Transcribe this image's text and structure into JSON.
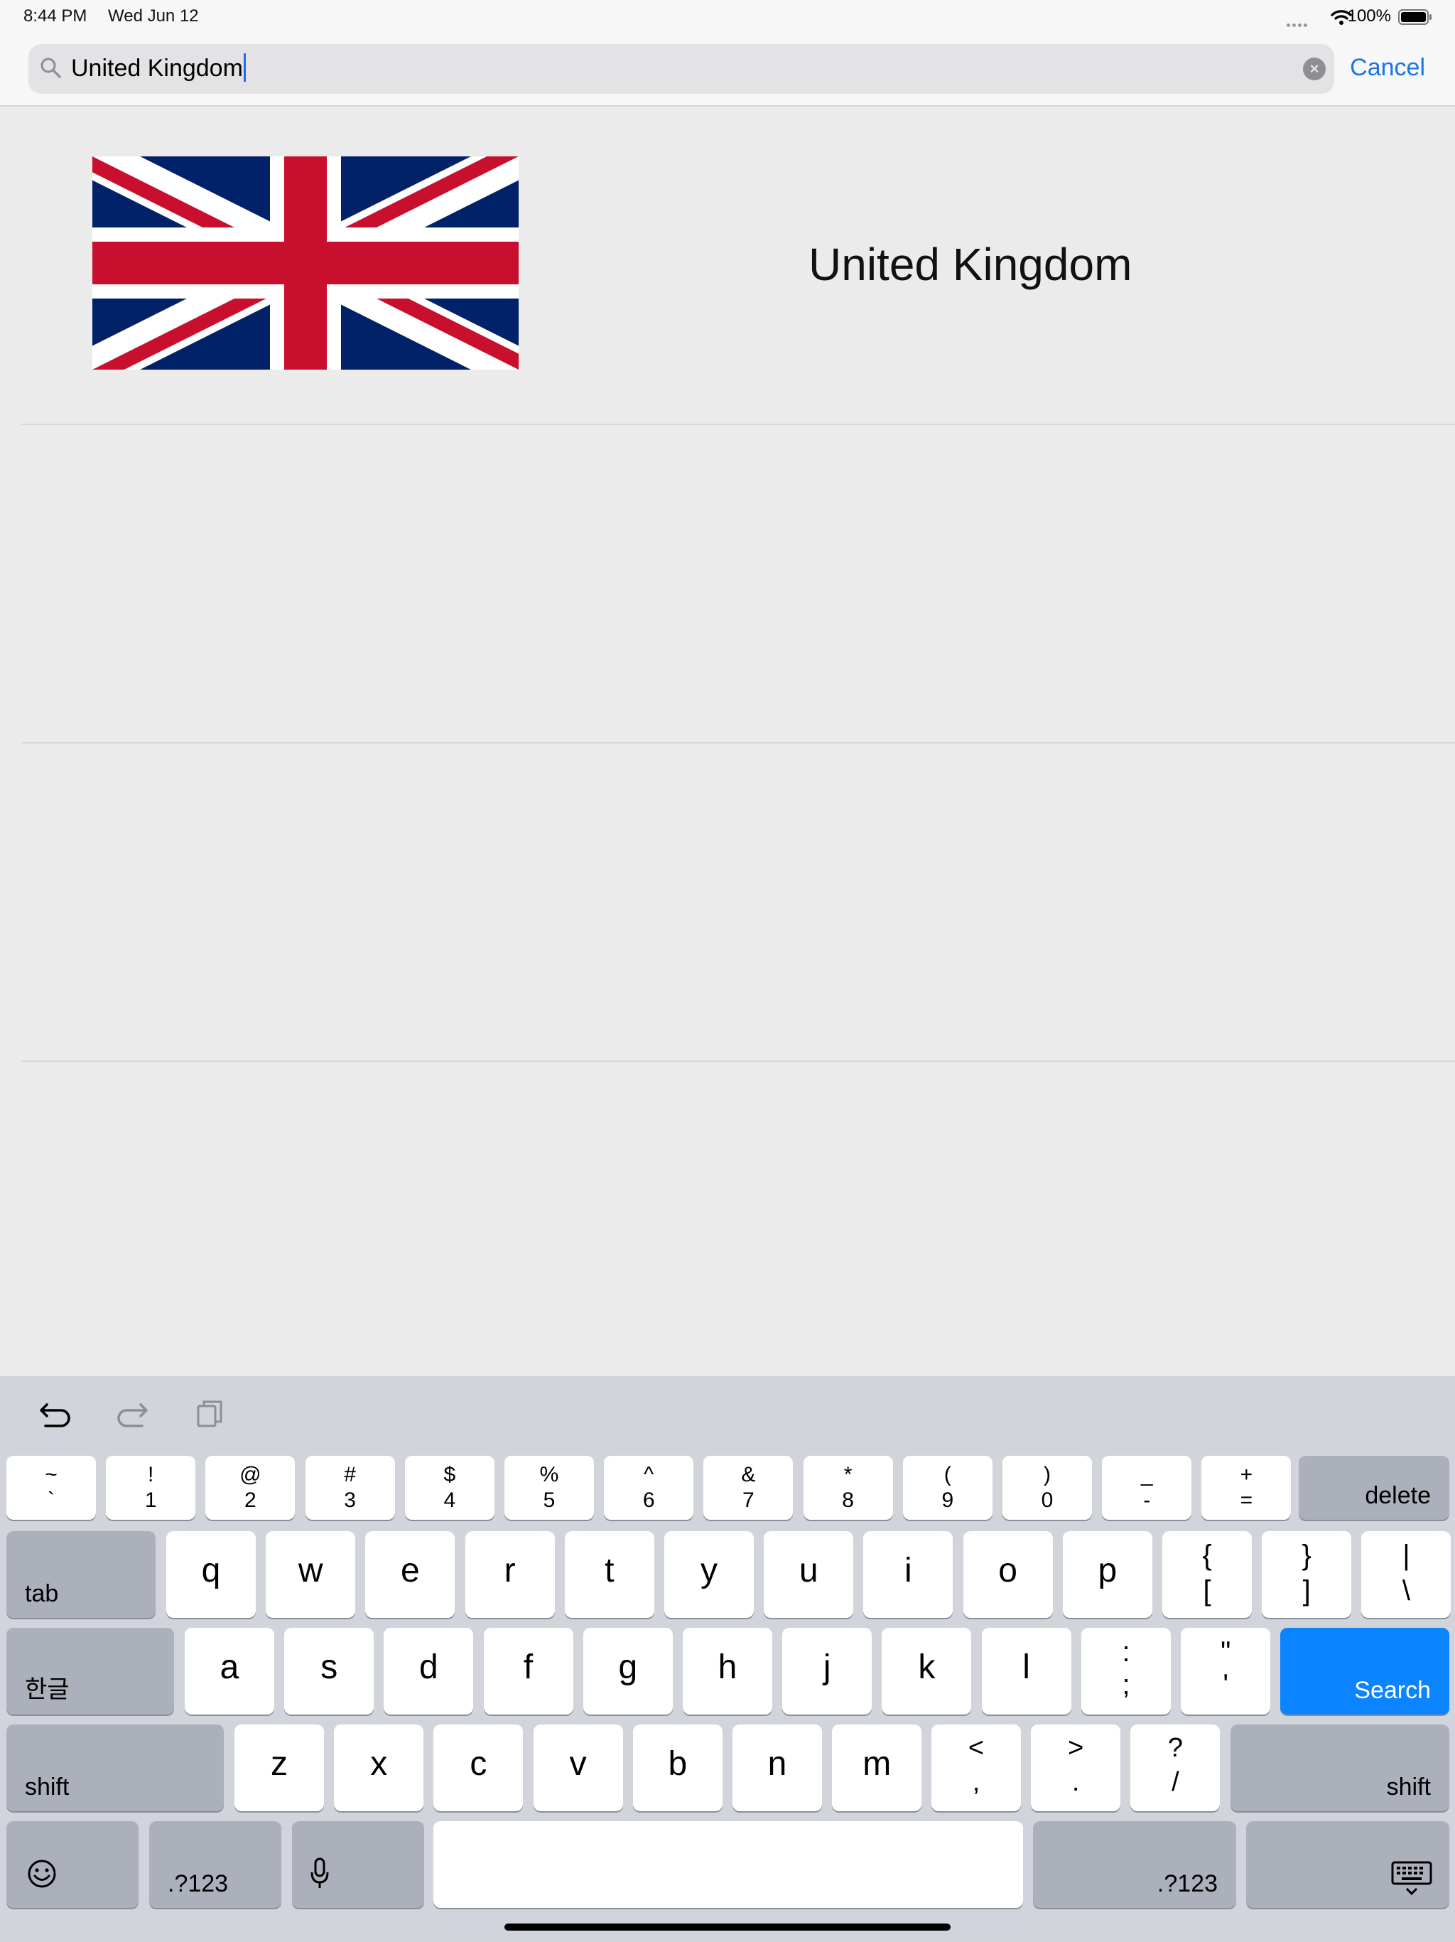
{
  "status_bar": {
    "time": "8:44 PM",
    "date": "Wed Jun 12",
    "battery": "100%",
    "icons": [
      "cellular-dots-icon",
      "wifi-icon",
      "battery-icon"
    ]
  },
  "search": {
    "value": "United Kingdom",
    "cancel_label": "Cancel",
    "icons": [
      "search-icon",
      "clear-icon"
    ]
  },
  "results": [
    {
      "name": "United Kingdom",
      "flag_icon": "union-jack-flag"
    }
  ],
  "keyboard_toolbar": {
    "icons": [
      "undo-icon",
      "redo-icon",
      "paste-icon"
    ]
  },
  "keyboard": {
    "number_row": [
      {
        "top": "~",
        "bottom": "`"
      },
      {
        "top": "!",
        "bottom": "1"
      },
      {
        "top": "@",
        "bottom": "2"
      },
      {
        "top": "#",
        "bottom": "3"
      },
      {
        "top": "$",
        "bottom": "4"
      },
      {
        "top": "%",
        "bottom": "5"
      },
      {
        "top": "^",
        "bottom": "6"
      },
      {
        "top": "&",
        "bottom": "7"
      },
      {
        "top": "*",
        "bottom": "8"
      },
      {
        "top": "(",
        "bottom": "9"
      },
      {
        "top": ")",
        "bottom": "0"
      },
      {
        "top": "_",
        "bottom": "-"
      },
      {
        "top": "+",
        "bottom": "="
      }
    ],
    "delete_label": "delete",
    "tab_label": "tab",
    "row_q": [
      "q",
      "w",
      "e",
      "r",
      "t",
      "y",
      "u",
      "i",
      "o",
      "p"
    ],
    "row_q_symbols": [
      {
        "top": "{",
        "bottom": "["
      },
      {
        "top": "}",
        "bottom": "]"
      },
      {
        "top": "|",
        "bottom": "\\"
      }
    ],
    "lang_label": "한글",
    "row_a": [
      "a",
      "s",
      "d",
      "f",
      "g",
      "h",
      "j",
      "k",
      "l"
    ],
    "row_a_symbols": [
      {
        "top": ":",
        "bottom": ";"
      },
      {
        "top": "\"",
        "bottom": "'"
      }
    ],
    "search_label": "Search",
    "shift_label": "shift",
    "row_z": [
      "z",
      "x",
      "c",
      "v",
      "b",
      "n",
      "m"
    ],
    "row_z_symbols": [
      {
        "top": "<",
        "bottom": ","
      },
      {
        "top": ">",
        "bottom": "."
      },
      {
        "top": "?",
        "bottom": "/"
      }
    ],
    "numbers_label": ".?123",
    "bottom_icons": [
      "emoji-icon",
      "microphone-icon",
      "dismiss-keyboard-icon"
    ],
    "accent_color": "#0a84ff"
  }
}
